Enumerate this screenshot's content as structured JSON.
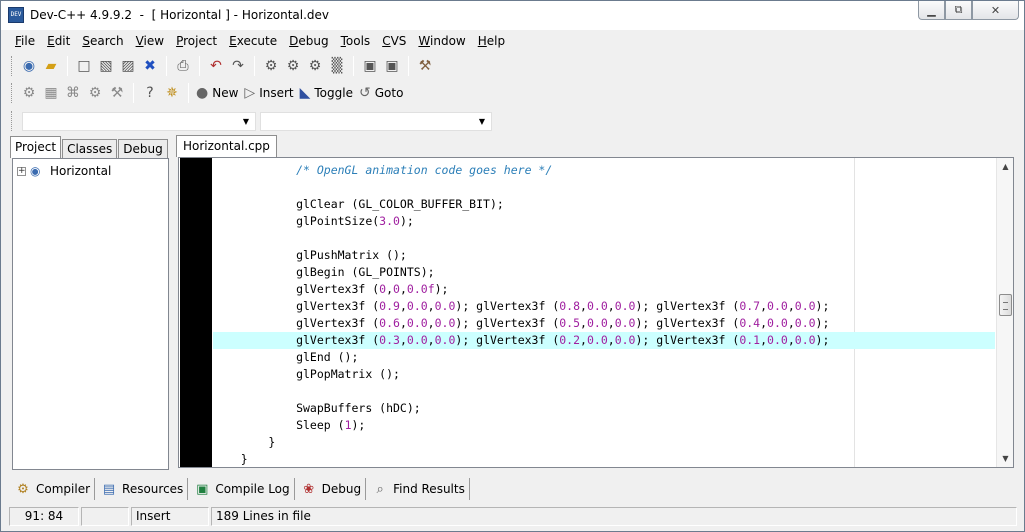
{
  "window": {
    "title": "Dev-C++ 4.9.9.2  -  [ Horizontal ] - Horizontal.dev",
    "app_icon_label": "DEV",
    "controls": [
      "minimize-icon",
      "maximize-icon",
      "close-icon"
    ]
  },
  "menu": [
    "File",
    "Edit",
    "Search",
    "View",
    "Project",
    "Execute",
    "Debug",
    "Tools",
    "CVS",
    "Window",
    "Help"
  ],
  "toolbar1": {
    "icons": [
      "new-project-icon",
      "open-icon",
      "new-source-icon",
      "save-icon",
      "save-all-icon",
      "close-icon",
      "print-icon",
      "undo-icon",
      "redo-icon",
      "compile-icon",
      "run-icon",
      "compile-run-icon",
      "rebuild-icon",
      "debug-icon",
      "add-file-icon",
      "project-options-icon"
    ]
  },
  "toolbar2": {
    "icons": [
      "goto-project-icon",
      "class-browser-icon",
      "find-icon",
      "replace-icon",
      "help-icon",
      "about-icon"
    ],
    "buttons": [
      {
        "label": "New",
        "icon": "new-icon"
      },
      {
        "label": "Insert",
        "icon": "insert-arrow-icon"
      },
      {
        "label": "Toggle",
        "icon": "bookmark-icon"
      },
      {
        "label": "Goto",
        "icon": "goto-icon"
      }
    ]
  },
  "combos": [
    {
      "value": ""
    },
    {
      "value": ""
    }
  ],
  "left_panel": {
    "tabs": [
      "Project",
      "Classes",
      "Debug"
    ],
    "active_tab": "Project",
    "tree": [
      {
        "label": "Horizontal",
        "expander": "+"
      }
    ]
  },
  "editor": {
    "tab": "Horizontal.cpp",
    "highlight_line_index": 10,
    "lines": [
      [
        {
          "t": "            ",
          "c": ""
        },
        {
          "t": "/* OpenGL animation code goes here */",
          "c": "comment"
        }
      ],
      [
        {
          "t": "",
          "c": ""
        }
      ],
      [
        {
          "t": "            glClear (GL_COLOR_BUFFER_BIT);",
          "c": ""
        }
      ],
      [
        {
          "t": "            glPointSize(",
          "c": ""
        },
        {
          "t": "3.0",
          "c": "num"
        },
        {
          "t": ");",
          "c": ""
        }
      ],
      [
        {
          "t": "",
          "c": ""
        }
      ],
      [
        {
          "t": "            glPushMatrix ();",
          "c": ""
        }
      ],
      [
        {
          "t": "            glBegin (GL_POINTS);",
          "c": ""
        }
      ],
      [
        {
          "t": "            glVertex3f (",
          "c": ""
        },
        {
          "t": "0",
          "c": "num"
        },
        {
          "t": ",",
          "c": ""
        },
        {
          "t": "0",
          "c": "num"
        },
        {
          "t": ",",
          "c": ""
        },
        {
          "t": "0.0f",
          "c": "num"
        },
        {
          "t": ");",
          "c": ""
        }
      ],
      [
        {
          "t": "            glVertex3f (",
          "c": ""
        },
        {
          "t": "0.9",
          "c": "num"
        },
        {
          "t": ",",
          "c": ""
        },
        {
          "t": "0.0",
          "c": "num"
        },
        {
          "t": ",",
          "c": ""
        },
        {
          "t": "0.0",
          "c": "num"
        },
        {
          "t": "); glVertex3f (",
          "c": ""
        },
        {
          "t": "0.8",
          "c": "num"
        },
        {
          "t": ",",
          "c": ""
        },
        {
          "t": "0.0",
          "c": "num"
        },
        {
          "t": ",",
          "c": ""
        },
        {
          "t": "0.0",
          "c": "num"
        },
        {
          "t": "); glVertex3f (",
          "c": ""
        },
        {
          "t": "0.7",
          "c": "num"
        },
        {
          "t": ",",
          "c": ""
        },
        {
          "t": "0.0",
          "c": "num"
        },
        {
          "t": ",",
          "c": ""
        },
        {
          "t": "0.0",
          "c": "num"
        },
        {
          "t": ");",
          "c": ""
        }
      ],
      [
        {
          "t": "            glVertex3f (",
          "c": ""
        },
        {
          "t": "0.6",
          "c": "num"
        },
        {
          "t": ",",
          "c": ""
        },
        {
          "t": "0.0",
          "c": "num"
        },
        {
          "t": ",",
          "c": ""
        },
        {
          "t": "0.0",
          "c": "num"
        },
        {
          "t": "); glVertex3f (",
          "c": ""
        },
        {
          "t": "0.5",
          "c": "num"
        },
        {
          "t": ",",
          "c": ""
        },
        {
          "t": "0.0",
          "c": "num"
        },
        {
          "t": ",",
          "c": ""
        },
        {
          "t": "0.0",
          "c": "num"
        },
        {
          "t": "); glVertex3f (",
          "c": ""
        },
        {
          "t": "0.4",
          "c": "num"
        },
        {
          "t": ",",
          "c": ""
        },
        {
          "t": "0.0",
          "c": "num"
        },
        {
          "t": ",",
          "c": ""
        },
        {
          "t": "0.0",
          "c": "num"
        },
        {
          "t": ");",
          "c": ""
        }
      ],
      [
        {
          "t": "            glVertex3f (",
          "c": ""
        },
        {
          "t": "0.3",
          "c": "num"
        },
        {
          "t": ",",
          "c": ""
        },
        {
          "t": "0.0",
          "c": "num"
        },
        {
          "t": ",",
          "c": ""
        },
        {
          "t": "0.0",
          "c": "num"
        },
        {
          "t": "); glVertex3f (",
          "c": ""
        },
        {
          "t": "0.2",
          "c": "num"
        },
        {
          "t": ",",
          "c": ""
        },
        {
          "t": "0.0",
          "c": "num"
        },
        {
          "t": ",",
          "c": ""
        },
        {
          "t": "0.0",
          "c": "num"
        },
        {
          "t": "); glVertex3f (",
          "c": ""
        },
        {
          "t": "0.1",
          "c": "num"
        },
        {
          "t": ",",
          "c": ""
        },
        {
          "t": "0.0",
          "c": "num"
        },
        {
          "t": ",",
          "c": ""
        },
        {
          "t": "0.0",
          "c": "num"
        },
        {
          "t": ");",
          "c": ""
        }
      ],
      [
        {
          "t": "            glEnd ();",
          "c": ""
        }
      ],
      [
        {
          "t": "            glPopMatrix ();",
          "c": ""
        }
      ],
      [
        {
          "t": "",
          "c": ""
        }
      ],
      [
        {
          "t": "            SwapBuffers (hDC);",
          "c": ""
        }
      ],
      [
        {
          "t": "            Sleep (",
          "c": ""
        },
        {
          "t": "1",
          "c": "num"
        },
        {
          "t": ");",
          "c": ""
        }
      ],
      [
        {
          "t": "        }",
          "c": ""
        }
      ],
      [
        {
          "t": "    }",
          "c": ""
        }
      ]
    ],
    "scroll_position": 0.47
  },
  "bottom_tabs": [
    {
      "label": "Compiler",
      "icon": "compiler-gears-icon"
    },
    {
      "label": "Resources",
      "icon": "resources-icon"
    },
    {
      "label": "Compile Log",
      "icon": "compile-log-icon"
    },
    {
      "label": "Debug",
      "icon": "debug-icon"
    },
    {
      "label": "Find Results",
      "icon": "find-results-icon"
    }
  ],
  "status": {
    "position": "91: 84",
    "modified": "",
    "mode": "Insert",
    "lines": "189 Lines in file"
  },
  "colors": {
    "comment": "#2c7fb8",
    "number": "#a020a0",
    "current_line": "#ccffff",
    "gutter": "#000000"
  }
}
